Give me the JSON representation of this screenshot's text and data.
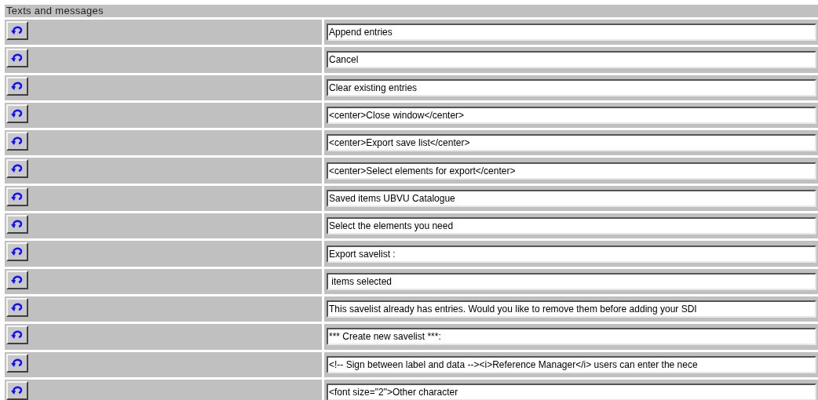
{
  "section": {
    "title": "Texts and messages"
  },
  "rows": [
    {
      "value": "Append entries"
    },
    {
      "value": "Cancel"
    },
    {
      "value": "Clear existing entries"
    },
    {
      "value": "<center>Close window</center>"
    },
    {
      "value": "<center>Export save list</center>"
    },
    {
      "value": "<center>Select elements for export</center>"
    },
    {
      "value": "Saved items UBVU Catalogue"
    },
    {
      "value": "Select the elements you need"
    },
    {
      "value": "Export savelist :"
    },
    {
      "value": " items selected"
    },
    {
      "value": "This savelist already has entries. Would you like to remove them before adding your SDI"
    },
    {
      "value": "*** Create new savelist ***:"
    },
    {
      "value": "<!-- Sign between label and data --><i>Reference Manager</i> users can enter the nece"
    },
    {
      "value": "<font size=\"2\">Other character"
    }
  ]
}
